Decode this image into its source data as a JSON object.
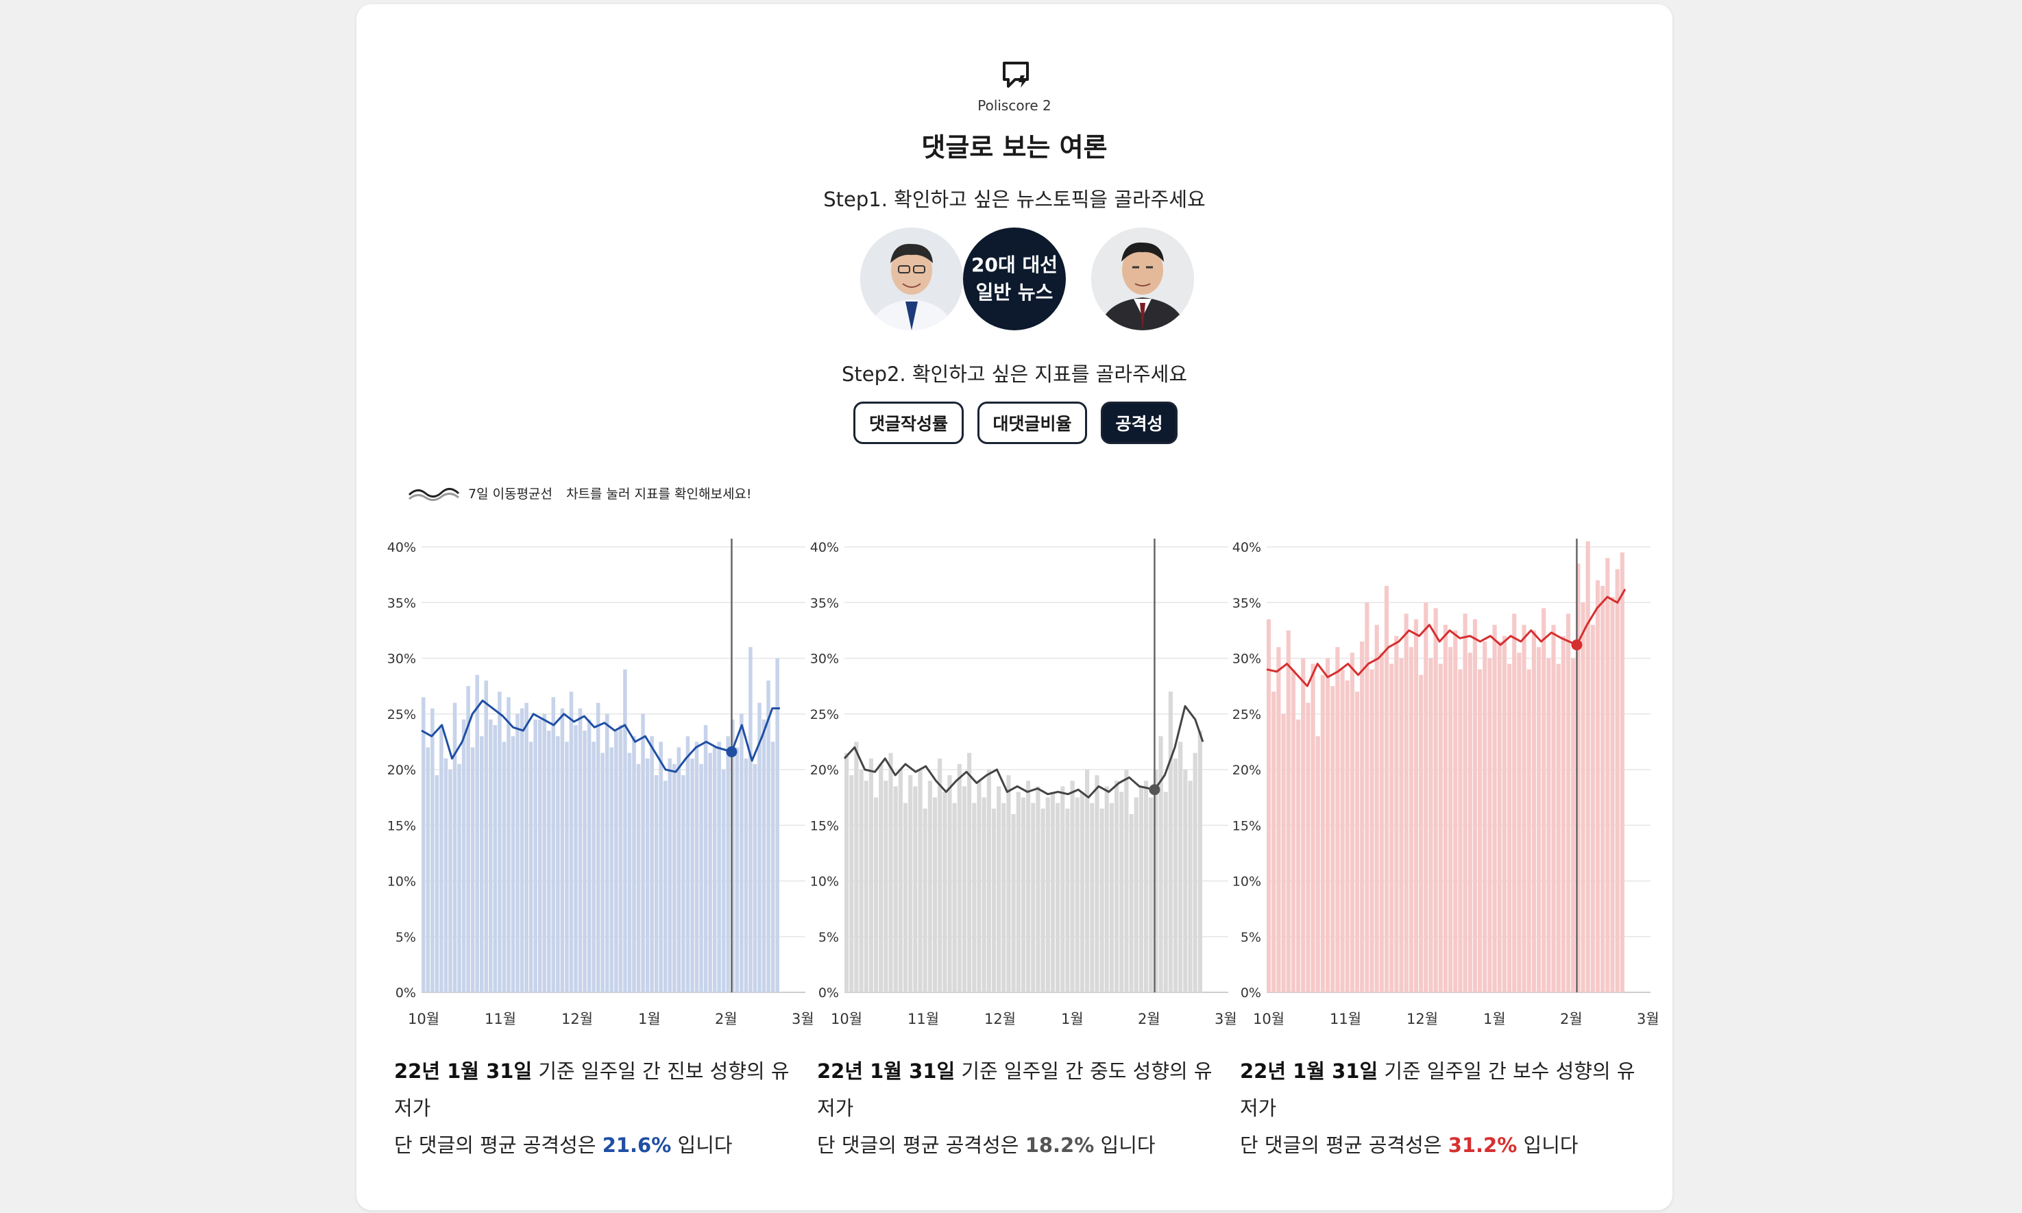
{
  "brand": {
    "name": "Poliscore 2",
    "icon": "chat-bubble-icon"
  },
  "title": "댓글로 보는 여론",
  "step1": "Step1. 확인하고 싶은 뉴스토픽을 골라주세요",
  "step2": "Step2. 확인하고 싶은 지표를 골라주세요",
  "topics": [
    {
      "name": "candidate-left-photo"
    },
    {
      "line1": "20대 대선",
      "line2": "일반 뉴스",
      "selected": true
    },
    {
      "name": "candidate-right-photo"
    }
  ],
  "metrics": [
    {
      "label": "댓글작성률",
      "selected": false
    },
    {
      "label": "대댓글비율",
      "selected": false
    },
    {
      "label": "공격성",
      "selected": true
    }
  ],
  "legend": {
    "ma_label": "7일 이동평균선",
    "hint": "차트를 눌러 지표를 확인해보세요!"
  },
  "summaries": [
    {
      "date": "22년 1월 31일",
      "text1": " 기준 일주일 간 진보 성향의 유저가",
      "text2": "단 댓글의 평균 공격성은 ",
      "value": "21.6%",
      "tail": " 입니다",
      "color": "#1f4fa3"
    },
    {
      "date": "22년 1월 31일",
      "text1": " 기준 일주일 간 중도 성향의 유저가",
      "text2": "단 댓글의 평균 공격성은 ",
      "value": "18.2%",
      "tail": " 입니다",
      "color": "#555555"
    },
    {
      "date": "22년 1월 31일",
      "text1": " 기준 일주일 간 보수 성향의 유저가",
      "text2": "단 댓글의 평균 공격성은 ",
      "value": "31.2%",
      "tail": " 입니다",
      "color": "#d62f2f"
    }
  ],
  "chart_data": [
    {
      "type": "bar",
      "series_group": "진보",
      "colors": {
        "bar": "#c7d3ea",
        "line": "#1f4fa3",
        "marker": "#1f4fa3"
      },
      "x_ticks": [
        "10월",
        "11월",
        "12월",
        "1월",
        "2월",
        "3월"
      ],
      "y_ticks": [
        "0%",
        "5%",
        "10%",
        "15%",
        "20%",
        "25%",
        "30%",
        "35%",
        "40%"
      ],
      "ylim": [
        0,
        40
      ],
      "grid": true,
      "marker_date": "2022-01-31",
      "marker_value": 21.6,
      "moving_average_7d": [
        {
          "x": "2021-10-01",
          "y": 23.5
        },
        {
          "x": "2021-10-05",
          "y": 23.0
        },
        {
          "x": "2021-10-09",
          "y": 24.0
        },
        {
          "x": "2021-10-13",
          "y": 21.0
        },
        {
          "x": "2021-10-17",
          "y": 22.5
        },
        {
          "x": "2021-10-21",
          "y": 25.0
        },
        {
          "x": "2021-10-25",
          "y": 26.2
        },
        {
          "x": "2021-10-29",
          "y": 25.5
        },
        {
          "x": "2021-11-02",
          "y": 24.8
        },
        {
          "x": "2021-11-06",
          "y": 23.8
        },
        {
          "x": "2021-11-10",
          "y": 23.5
        },
        {
          "x": "2021-11-14",
          "y": 25.0
        },
        {
          "x": "2021-11-18",
          "y": 24.5
        },
        {
          "x": "2021-11-22",
          "y": 24.0
        },
        {
          "x": "2021-11-26",
          "y": 25.0
        },
        {
          "x": "2021-11-30",
          "y": 24.3
        },
        {
          "x": "2021-12-04",
          "y": 24.8
        },
        {
          "x": "2021-12-08",
          "y": 23.8
        },
        {
          "x": "2021-12-12",
          "y": 24.2
        },
        {
          "x": "2021-12-16",
          "y": 23.5
        },
        {
          "x": "2021-12-20",
          "y": 24.0
        },
        {
          "x": "2021-12-24",
          "y": 22.5
        },
        {
          "x": "2021-12-28",
          "y": 23.0
        },
        {
          "x": "2022-01-01",
          "y": 21.5
        },
        {
          "x": "2022-01-05",
          "y": 20.0
        },
        {
          "x": "2022-01-09",
          "y": 19.8
        },
        {
          "x": "2022-01-13",
          "y": 21.0
        },
        {
          "x": "2022-01-17",
          "y": 22.0
        },
        {
          "x": "2022-01-21",
          "y": 22.5
        },
        {
          "x": "2022-01-25",
          "y": 22.0
        },
        {
          "x": "2022-01-31",
          "y": 21.6
        },
        {
          "x": "2022-02-04",
          "y": 24.0
        },
        {
          "x": "2022-02-08",
          "y": 20.8
        },
        {
          "x": "2022-02-12",
          "y": 23.0
        },
        {
          "x": "2022-02-16",
          "y": 25.5
        },
        {
          "x": "2022-02-19",
          "y": 25.5
        }
      ],
      "daily_values": [
        26.5,
        22.0,
        25.5,
        19.5,
        24.0,
        21.0,
        20.0,
        26.0,
        20.5,
        24.5,
        27.5,
        22.0,
        28.5,
        23.0,
        28.0,
        24.5,
        24.0,
        27.0,
        22.5,
        26.5,
        23.0,
        25.0,
        25.5,
        26.0,
        22.5,
        24.5,
        24.5,
        25.0,
        23.5,
        26.5,
        23.0,
        25.5,
        22.5,
        27.0,
        24.0,
        25.5,
        23.5,
        24.5,
        22.5,
        26.0,
        21.5,
        25.0,
        22.0,
        23.5,
        24.0,
        29.0,
        21.5,
        23.0,
        20.5,
        25.0,
        21.0,
        23.0,
        19.5,
        22.5,
        19.0,
        21.0,
        20.5,
        22.0,
        19.5,
        23.0,
        21.0,
        22.5,
        20.5,
        24.0,
        21.5,
        22.0,
        22.5,
        20.0,
        23.0,
        24.5,
        22.0,
        25.0,
        21.0,
        31.0,
        20.5,
        26.0,
        24.5,
        28.0,
        22.5,
        30.0
      ]
    },
    {
      "type": "bar",
      "series_group": "중도",
      "colors": {
        "bar": "#d9d9d9",
        "line": "#444444",
        "marker": "#555555"
      },
      "x_ticks": [
        "10월",
        "11월",
        "12월",
        "1월",
        "2월",
        "3월"
      ],
      "y_ticks": [
        "0%",
        "5%",
        "10%",
        "15%",
        "20%",
        "25%",
        "30%",
        "35%",
        "40%"
      ],
      "ylim": [
        0,
        40
      ],
      "grid": true,
      "marker_date": "2022-01-31",
      "marker_value": 18.2,
      "moving_average_7d": [
        {
          "x": "2021-10-01",
          "y": 21.0
        },
        {
          "x": "2021-10-05",
          "y": 22.0
        },
        {
          "x": "2021-10-09",
          "y": 20.0
        },
        {
          "x": "2021-10-13",
          "y": 19.8
        },
        {
          "x": "2021-10-17",
          "y": 21.0
        },
        {
          "x": "2021-10-21",
          "y": 19.5
        },
        {
          "x": "2021-10-25",
          "y": 20.5
        },
        {
          "x": "2021-10-29",
          "y": 19.8
        },
        {
          "x": "2021-11-02",
          "y": 20.3
        },
        {
          "x": "2021-11-06",
          "y": 19.0
        },
        {
          "x": "2021-11-10",
          "y": 18.0
        },
        {
          "x": "2021-11-14",
          "y": 19.0
        },
        {
          "x": "2021-11-18",
          "y": 19.8
        },
        {
          "x": "2021-11-22",
          "y": 18.8
        },
        {
          "x": "2021-11-26",
          "y": 19.5
        },
        {
          "x": "2021-11-30",
          "y": 20.0
        },
        {
          "x": "2021-12-04",
          "y": 18.0
        },
        {
          "x": "2021-12-08",
          "y": 18.5
        },
        {
          "x": "2021-12-12",
          "y": 18.0
        },
        {
          "x": "2021-12-16",
          "y": 18.3
        },
        {
          "x": "2021-12-20",
          "y": 17.8
        },
        {
          "x": "2021-12-24",
          "y": 18.0
        },
        {
          "x": "2021-12-28",
          "y": 17.8
        },
        {
          "x": "2022-01-01",
          "y": 18.2
        },
        {
          "x": "2022-01-05",
          "y": 17.5
        },
        {
          "x": "2022-01-09",
          "y": 18.5
        },
        {
          "x": "2022-01-13",
          "y": 18.0
        },
        {
          "x": "2022-01-17",
          "y": 18.8
        },
        {
          "x": "2022-01-21",
          "y": 19.3
        },
        {
          "x": "2022-01-25",
          "y": 18.5
        },
        {
          "x": "2022-01-31",
          "y": 18.2
        },
        {
          "x": "2022-02-04",
          "y": 19.5
        },
        {
          "x": "2022-02-08",
          "y": 22.0
        },
        {
          "x": "2022-02-12",
          "y": 25.7
        },
        {
          "x": "2022-02-16",
          "y": 24.5
        },
        {
          "x": "2022-02-19",
          "y": 22.5
        }
      ],
      "daily_values": [
        21.5,
        19.5,
        22.5,
        20.0,
        19.0,
        21.0,
        17.5,
        20.5,
        19.0,
        21.5,
        18.5,
        20.0,
        17.0,
        19.5,
        18.5,
        20.0,
        16.5,
        19.0,
        17.5,
        21.0,
        18.0,
        19.5,
        17.0,
        20.5,
        18.5,
        21.5,
        17.0,
        19.0,
        17.5,
        20.0,
        16.5,
        18.5,
        17.0,
        19.5,
        16.0,
        18.0,
        17.5,
        19.0,
        17.0,
        18.5,
        16.5,
        17.5,
        18.0,
        17.0,
        18.5,
        16.5,
        19.0,
        17.5,
        18.0,
        20.0,
        17.0,
        19.5,
        16.5,
        18.5,
        17.0,
        19.0,
        18.0,
        20.0,
        16.0,
        17.5,
        18.5,
        19.0,
        17.5,
        20.0,
        23.0,
        18.0,
        27.0,
        21.0,
        22.5,
        20.0,
        19.0,
        21.5,
        23.5
      ]
    },
    {
      "type": "bar",
      "series_group": "보수",
      "colors": {
        "bar": "#f6c9c9",
        "line": "#d62f2f",
        "marker": "#d62f2f"
      },
      "x_ticks": [
        "10월",
        "11월",
        "12월",
        "1월",
        "2월",
        "3월"
      ],
      "y_ticks": [
        "0%",
        "5%",
        "10%",
        "15%",
        "20%",
        "25%",
        "30%",
        "35%",
        "40%"
      ],
      "ylim": [
        0,
        40
      ],
      "grid": true,
      "marker_date": "2022-01-31",
      "marker_value": 31.2,
      "moving_average_7d": [
        {
          "x": "2021-10-01",
          "y": 29.0
        },
        {
          "x": "2021-10-05",
          "y": 28.8
        },
        {
          "x": "2021-10-09",
          "y": 29.5
        },
        {
          "x": "2021-10-13",
          "y": 28.5
        },
        {
          "x": "2021-10-17",
          "y": 27.5
        },
        {
          "x": "2021-10-21",
          "y": 29.5
        },
        {
          "x": "2021-10-25",
          "y": 28.3
        },
        {
          "x": "2021-10-29",
          "y": 28.8
        },
        {
          "x": "2021-11-02",
          "y": 29.5
        },
        {
          "x": "2021-11-06",
          "y": 28.5
        },
        {
          "x": "2021-11-10",
          "y": 29.5
        },
        {
          "x": "2021-11-14",
          "y": 30.0
        },
        {
          "x": "2021-11-18",
          "y": 31.0
        },
        {
          "x": "2021-11-22",
          "y": 31.5
        },
        {
          "x": "2021-11-26",
          "y": 32.5
        },
        {
          "x": "2021-11-30",
          "y": 32.0
        },
        {
          "x": "2021-12-04",
          "y": 33.0
        },
        {
          "x": "2021-12-08",
          "y": 31.5
        },
        {
          "x": "2021-12-12",
          "y": 32.5
        },
        {
          "x": "2021-12-16",
          "y": 31.8
        },
        {
          "x": "2021-12-20",
          "y": 32.0
        },
        {
          "x": "2021-12-24",
          "y": 31.5
        },
        {
          "x": "2021-12-28",
          "y": 32.0
        },
        {
          "x": "2022-01-01",
          "y": 31.2
        },
        {
          "x": "2022-01-05",
          "y": 32.0
        },
        {
          "x": "2022-01-09",
          "y": 31.5
        },
        {
          "x": "2022-01-13",
          "y": 32.5
        },
        {
          "x": "2022-01-17",
          "y": 31.5
        },
        {
          "x": "2022-01-21",
          "y": 32.3
        },
        {
          "x": "2022-01-25",
          "y": 31.8
        },
        {
          "x": "2022-01-31",
          "y": 31.2
        },
        {
          "x": "2022-02-04",
          "y": 33.0
        },
        {
          "x": "2022-02-08",
          "y": 34.5
        },
        {
          "x": "2022-02-12",
          "y": 35.5
        },
        {
          "x": "2022-02-16",
          "y": 35.0
        },
        {
          "x": "2022-02-19",
          "y": 36.2
        }
      ],
      "daily_values": [
        33.5,
        27.0,
        31.0,
        25.0,
        32.5,
        29.0,
        24.5,
        30.0,
        26.0,
        29.5,
        23.0,
        28.5,
        30.0,
        27.5,
        31.0,
        29.0,
        28.0,
        30.5,
        27.0,
        31.5,
        35.0,
        29.0,
        33.0,
        30.5,
        36.5,
        29.5,
        32.0,
        30.0,
        34.0,
        31.0,
        33.5,
        28.5,
        35.0,
        30.0,
        34.5,
        29.5,
        33.0,
        31.0,
        32.5,
        29.0,
        34.0,
        30.5,
        33.5,
        29.0,
        31.5,
        30.0,
        33.0,
        31.5,
        32.0,
        29.5,
        34.0,
        30.5,
        33.0,
        29.0,
        32.5,
        31.0,
        34.5,
        30.0,
        33.0,
        29.5,
        32.0,
        34.0,
        30.0,
        38.5,
        35.0,
        40.5,
        33.0,
        37.0,
        36.5,
        39.0,
        35.5,
        38.0,
        39.5
      ]
    }
  ]
}
